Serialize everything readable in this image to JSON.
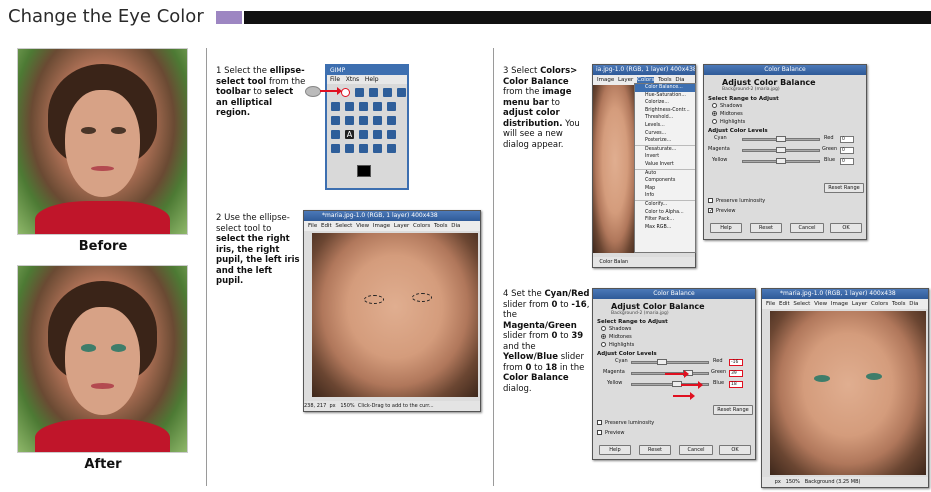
{
  "title": "Change the Eye Color",
  "captions": {
    "before": "Before",
    "after": "After"
  },
  "steps": {
    "s1": {
      "num": "1",
      "t1": "Select the",
      "b1": "ellipse-select tool",
      "t2": "from the",
      "b2": "toolbar",
      "t3": "to",
      "b3": "select an elliptical region."
    },
    "s2": {
      "num": "2",
      "t1": "Use the ellipse-select tool to",
      "b1": "select the right iris, the right pupil, the left iris",
      "t2": "and the left pupil."
    },
    "s3": {
      "num": "3",
      "t1": "Select",
      "b1": "Colors> Color Balance",
      "t2": "from the",
      "b2": "image menu bar",
      "t3": "to",
      "b3": "adjust color distribution.",
      "t4": "You will see a new dialog appear."
    },
    "s4": {
      "num": "4",
      "t1": "Set the",
      "b1": "Cyan/Red",
      "t2": "slider from",
      "b2": "0",
      "t3": "to",
      "b3": "-16",
      "t4": ", the",
      "b4": "Magenta/Green",
      "t5": "slider from",
      "b5": "0",
      "t6": "to",
      "b6": "39",
      "t7": "and the",
      "b7": "Yellow/Blue",
      "t8": "slider from",
      "b8": "0",
      "t9": "to",
      "b9": "18",
      "t10": "in the",
      "b10": "Color Balance",
      "t11": "dialog."
    }
  },
  "toolbox": {
    "title": "GIMP",
    "menu": [
      "File",
      "Xtns",
      "Help"
    ]
  },
  "image_window": {
    "title": "*maria.jpg-1.0 (RGB, 1 layer) 400x438",
    "menu": [
      "File",
      "Edit",
      "Select",
      "View",
      "Image",
      "Layer",
      "Colors",
      "Tools",
      "Dia"
    ],
    "coords": "238, 217",
    "unit": "px",
    "zoom": "150%",
    "status": "Click-Drag to add to the curr..."
  },
  "colors_window": {
    "title": "ia.jpg-1.0 (RGB, 1 layer) 400x438",
    "menu": [
      "Image",
      "Layer",
      "Colors",
      "Tools",
      "Dia"
    ],
    "zoom_tag": "Color Balan",
    "menu_items": [
      "Color Balance...",
      "Hue-Saturation...",
      "Colorize...",
      "Brightness-Contr...",
      "Threshold...",
      "Levels...",
      "Curves...",
      "Posterize...",
      "Desaturate...",
      "Invert",
      "Value Invert",
      "Auto",
      "Components",
      "Map",
      "Info",
      "Colorify...",
      "Color to Alpha...",
      "Filter Pack...",
      "Max RGB..."
    ]
  },
  "color_balance_1": {
    "title": "Color Balance",
    "heading": "Adjust Color Balance",
    "sub": "Background-2 (maria.jpg)",
    "range_label": "Select Range to Adjust",
    "ranges": [
      "Shadows",
      "Midtones",
      "Highlights"
    ],
    "levels_label": "Adjust Color Levels",
    "left_labels": [
      "Cyan",
      "Magenta",
      "Yellow"
    ],
    "right_labels": [
      "Red",
      "Green",
      "Blue"
    ],
    "values": [
      "0",
      "0",
      "0"
    ],
    "reset": "Reset Range",
    "preserve": "Preserve luminosity",
    "preview": "Preview",
    "buttons": [
      "Help",
      "Reset",
      "Cancel",
      "OK"
    ]
  },
  "color_balance_2": {
    "title": "Color Balance",
    "heading": "Adjust Color Balance",
    "sub": "Background-2 (maria.jpg)",
    "range_label": "Select Range to Adjust",
    "ranges": [
      "Shadows",
      "Midtones",
      "Highlights"
    ],
    "levels_label": "Adjust Color Levels",
    "left_labels": [
      "Cyan",
      "Magenta",
      "Yellow"
    ],
    "right_labels": [
      "Red",
      "Green",
      "Blue"
    ],
    "values": [
      "-16",
      "39",
      "18"
    ],
    "reset": "Reset Range",
    "preserve": "Preserve luminosity",
    "preview": "Preview",
    "buttons": [
      "Help",
      "Reset",
      "Cancel",
      "OK"
    ]
  },
  "result_window": {
    "title": "*maria.jpg-1.0 (RGB, 1 layer) 400x438",
    "menu": [
      "File",
      "Edit",
      "Select",
      "View",
      "Image",
      "Layer",
      "Colors",
      "Tools",
      "Dia"
    ],
    "unit": "px",
    "zoom": "150%",
    "status": "Background (3.25 MB)"
  },
  "theme": {
    "accent": "#9d86c2",
    "bar": "#111111",
    "title_blue": "#3d6fb0",
    "highlight_red": "#e01020"
  }
}
